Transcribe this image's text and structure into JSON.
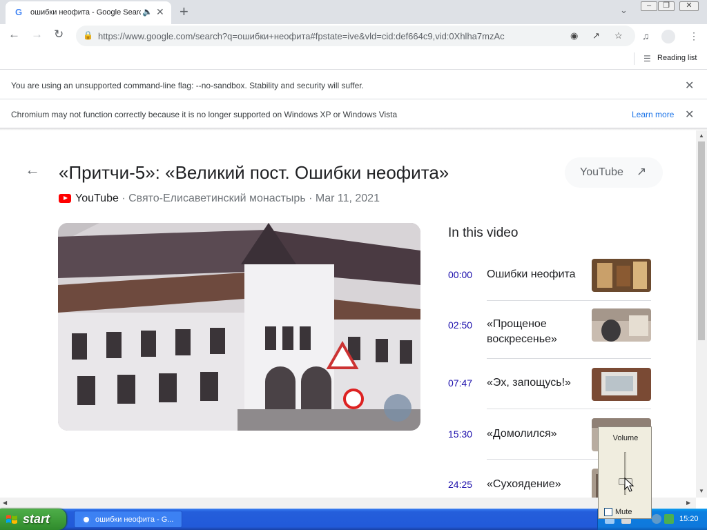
{
  "tab": {
    "title": "ошибки неофита - Google Search",
    "favicon": "G"
  },
  "toolbar": {
    "url": "https://www.google.com/search?q=ошибки+неофита#fpstate=ive&vld=cid:def664c9,vid:0Xhlha7mzAc"
  },
  "bookmarks": {
    "reading_list": "Reading list"
  },
  "infobars": {
    "flag": "You are using an unsupported command-line flag: --no-sandbox. Stability and security will suffer.",
    "xp": "Chromium may not function correctly because it is no longer supported on Windows XP or Windows Vista",
    "learn_more": "Learn more"
  },
  "video": {
    "title": "«Притчи-5»: «Великий пост. Ошибки неофита»",
    "source": "YouTube",
    "channel": " · Свято-Елисаветинский монастырь · Mar 11, 2021",
    "youtube_button": "YouTube"
  },
  "chapters_heading": "In this video",
  "chapters": [
    {
      "time": "00:00",
      "name": "Ошибки неофита"
    },
    {
      "time": "02:50",
      "name": "«Прощеное воскресенье»"
    },
    {
      "time": "07:47",
      "name": "«Эх, запощусь!»"
    },
    {
      "time": "15:30",
      "name": "«Домолился»"
    },
    {
      "time": "24:25",
      "name": "«Сухоядение»"
    }
  ],
  "taskbar": {
    "start": "start",
    "task_label": "ошибки неофита - G...",
    "clock": "15:20"
  },
  "volume": {
    "label": "Volume",
    "mute": "Mute",
    "level": 0.3
  }
}
